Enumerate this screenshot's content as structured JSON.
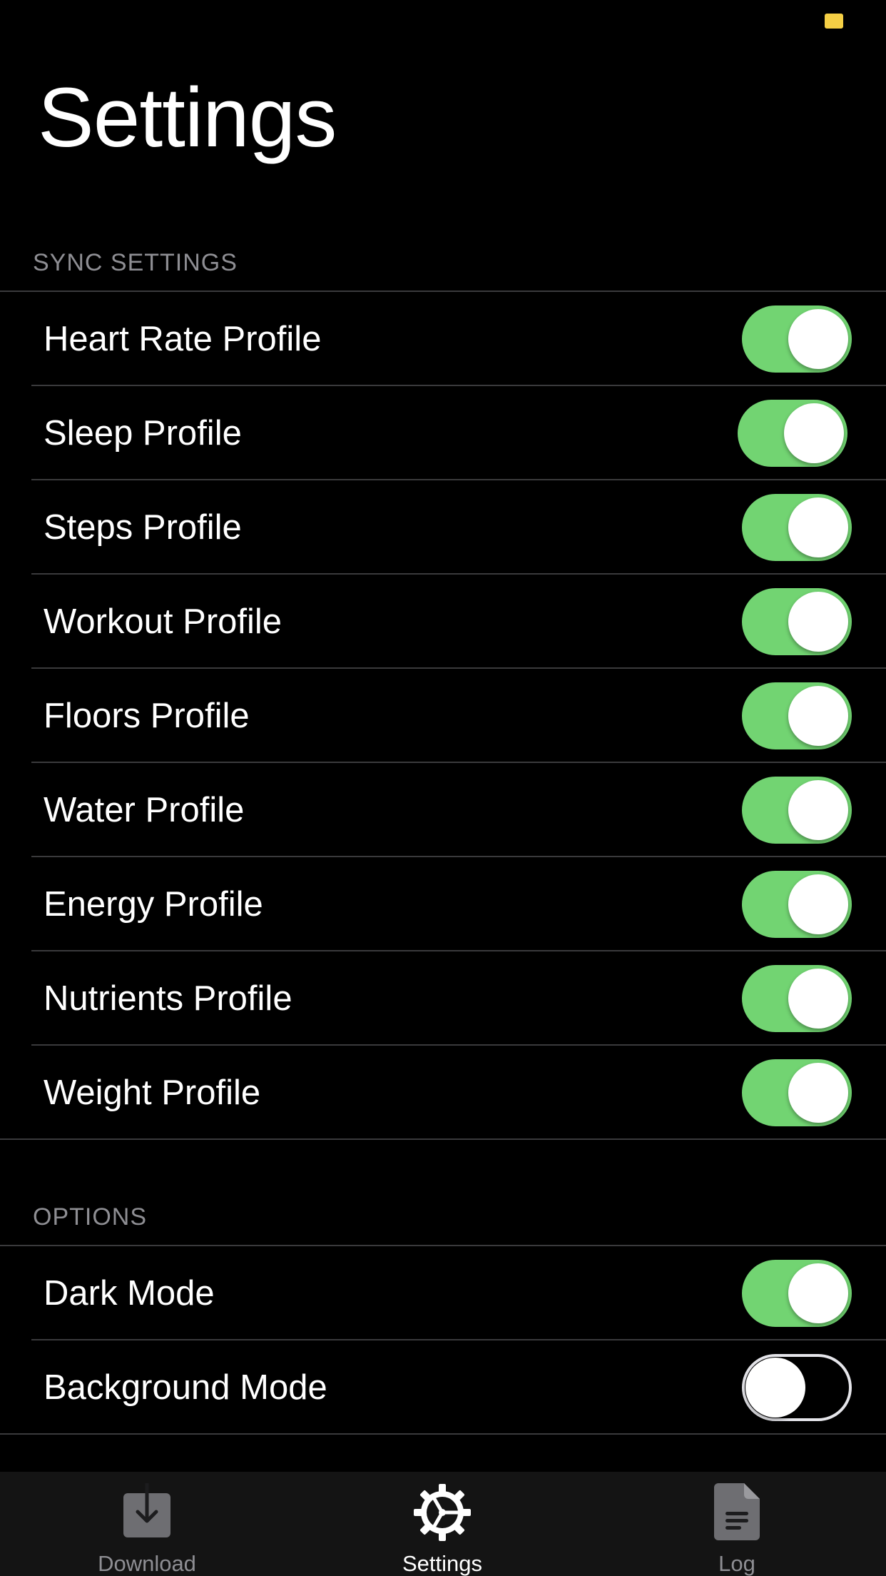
{
  "page": {
    "title": "Settings"
  },
  "colors": {
    "background": "#000000",
    "toggle_on": "#72d472",
    "separator": "#3a3a3c",
    "section_header": "#8e8e93",
    "tab_bar": "#141414",
    "battery": "#f5cf45"
  },
  "sync_settings": {
    "header": "SYNC SETTINGS",
    "items": [
      {
        "label": "Heart Rate Profile",
        "enabled": true
      },
      {
        "label": "Sleep Profile",
        "enabled": true
      },
      {
        "label": "Steps Profile",
        "enabled": true
      },
      {
        "label": "Workout Profile",
        "enabled": true
      },
      {
        "label": "Floors Profile",
        "enabled": true
      },
      {
        "label": "Water Profile",
        "enabled": true
      },
      {
        "label": "Energy Profile",
        "enabled": true
      },
      {
        "label": "Nutrients Profile",
        "enabled": true
      },
      {
        "label": "Weight Profile",
        "enabled": true
      }
    ]
  },
  "options": {
    "header": "OPTIONS",
    "items": [
      {
        "label": "Dark Mode",
        "enabled": true
      },
      {
        "label": "Background Mode",
        "enabled": false
      }
    ]
  },
  "tab_bar": {
    "tabs": [
      {
        "label": "Download",
        "icon": "download-icon",
        "active": false
      },
      {
        "label": "Settings",
        "icon": "gear-icon",
        "active": true
      },
      {
        "label": "Log",
        "icon": "document-icon",
        "active": false
      }
    ]
  }
}
